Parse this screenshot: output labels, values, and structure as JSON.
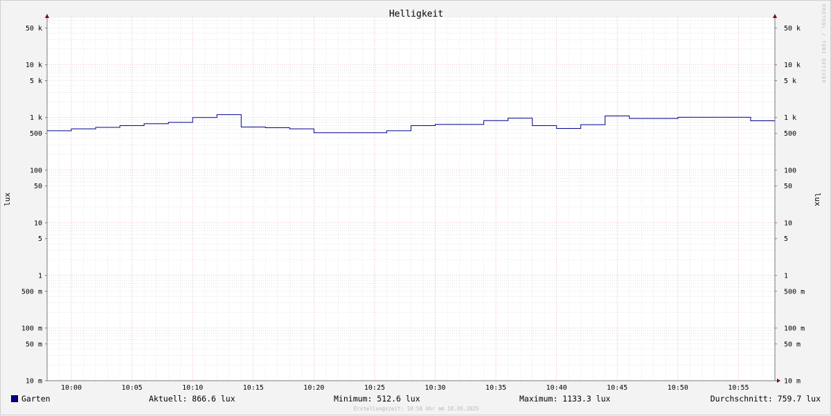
{
  "chart_data": {
    "type": "line",
    "title": "Helligkeit",
    "ylabel": "lux",
    "yscale": "log",
    "ylim": [
      0.01,
      80000
    ],
    "xlim": [
      "09:58",
      "10:58"
    ],
    "x_ticks": [
      "10:00",
      "10:05",
      "10:10",
      "10:15",
      "10:20",
      "10:25",
      "10:30",
      "10:35",
      "10:40",
      "10:45",
      "10:50",
      "10:55"
    ],
    "y_tick_values": [
      50000,
      10000,
      5000,
      1000,
      500,
      100,
      50,
      10,
      5,
      1,
      0.5,
      0.1,
      0.05,
      0.01
    ],
    "y_tick_labels": [
      "50 k",
      "10 k",
      "5 k",
      "1 k",
      "500",
      "100",
      "50",
      "10",
      "5",
      "1",
      "500 m",
      "100 m",
      "50 m",
      "10 m"
    ],
    "grid": true,
    "series": [
      {
        "name": "Garten",
        "color": "#00008b",
        "x": [
          "09:58",
          "10:00",
          "10:02",
          "10:04",
          "10:06",
          "10:08",
          "10:10",
          "10:12",
          "10:14",
          "10:16",
          "10:18",
          "10:20",
          "10:26",
          "10:28",
          "10:30",
          "10:34",
          "10:36",
          "10:38",
          "10:40",
          "10:42",
          "10:44",
          "10:46",
          "10:50",
          "10:56",
          "10:58"
        ],
        "values": [
          560,
          610,
          650,
          700,
          760,
          810,
          1000,
          1133.3,
          660,
          640,
          610,
          512.6,
          560,
          700,
          740,
          870,
          970,
          700,
          620,
          730,
          1070,
          960,
          1010,
          866.6,
          866.6
        ]
      }
    ]
  },
  "watermark": "RRDTOOL / TOBI OETIKER",
  "legend": {
    "series_name": "Garten",
    "swatch_color": "#00008b",
    "current": "Aktuell: 866.6 lux",
    "minimum": "Minimum: 512.6 lux",
    "maximum": "Maximum: 1133.3 lux",
    "average": "Durchschnitt: 759.7 lux"
  },
  "footer": "Erstellungszeit: 10:58 Uhr am 18.05.2025"
}
